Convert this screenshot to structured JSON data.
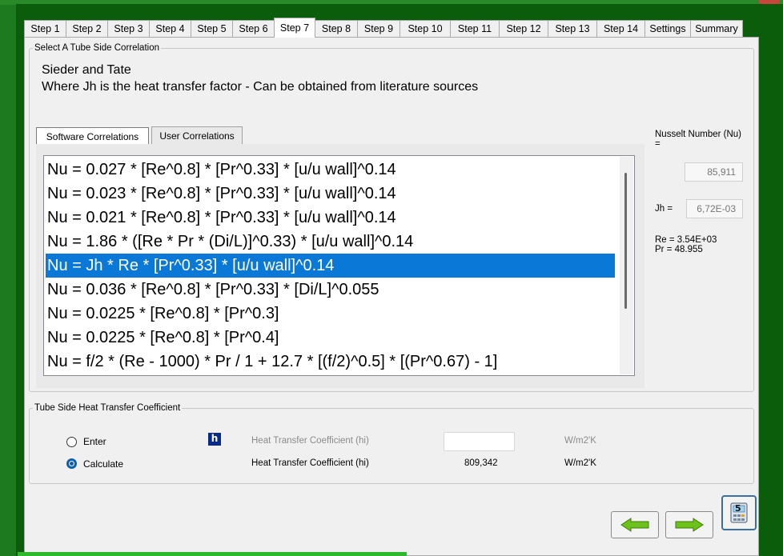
{
  "tabs": [
    "Step 1",
    "Step 2",
    "Step 3",
    "Step 4",
    "Step 5",
    "Step 6",
    "Step 7",
    "Step 8",
    "Step 9",
    "Step 10",
    "Step 11",
    "Step 12",
    "Step 13",
    "Step 14",
    "Settings",
    "Summary"
  ],
  "active_tab": "Step 7",
  "correlation_group": {
    "legend": "Select A Tube Side Correlation",
    "name": "Sieder and Tate",
    "description": "Where Jh is the heat transfer factor - Can be obtained from literature sources",
    "subtabs": [
      "Software Correlations",
      "User Correlations"
    ],
    "items": [
      "Nu = 0.027 * [Re^0.8] * [Pr^0.33] * [u/u wall]^0.14",
      "Nu = 0.023 * [Re^0.8] * [Pr^0.33] * [u/u wall]^0.14",
      "Nu = 0.021 * [Re^0.8] * [Pr^0.33] * [u/u wall]^0.14",
      "Nu = 1.86 * ([Re * Pr * (Di/L)]^0.33) * [u/u wall]^0.14",
      "Nu = Jh * Re * [Pr^0.33] * [u/u wall]^0.14",
      "Nu = 0.036 * [Re^0.8] * [Pr^0.33] * [Di/L]^0.055",
      "Nu = 0.0225 * [Re^0.8] * [Pr^0.3]",
      "Nu = 0.0225 * [Re^0.8] * [Pr^0.4]",
      "Nu = f/2 * (Re - 1000) * Pr / 1 + 12.7 * [(f/2)^0.5] * [(Pr^0.67) - 1]"
    ],
    "selected_index": 4
  },
  "results": {
    "nusselt_label": "Nusselt Number (Nu) =",
    "nusselt_value": "85,911",
    "jh_label": "Jh =",
    "jh_value": "6,72E-03",
    "re_text": "Re = 3.54E+03",
    "pr_text": "Pr = 48.955"
  },
  "htc_group": {
    "legend": "Tube Side Heat Transfer Coefficient",
    "enter_label": "Enter",
    "calculate_label": "Calculate",
    "h_icon": "h",
    "enter_field_label": "Heat Transfer Coefficient (hi)",
    "enter_value": "",
    "enter_unit": "W/m2'K",
    "calc_field_label": "Heat Transfer Coefficient (hi)",
    "calc_value": "809,342",
    "calc_unit": "W/m2'K",
    "selected": "Calculate"
  },
  "nav": {
    "back_icon": "arrow-left-icon",
    "next_icon": "arrow-right-icon",
    "calculator_icon": "calculator-icon",
    "calculator_badge": "5"
  },
  "colors": {
    "frame": "#0b5c0b",
    "selection": "#0a78d7",
    "arrow": "#6cc11a"
  }
}
